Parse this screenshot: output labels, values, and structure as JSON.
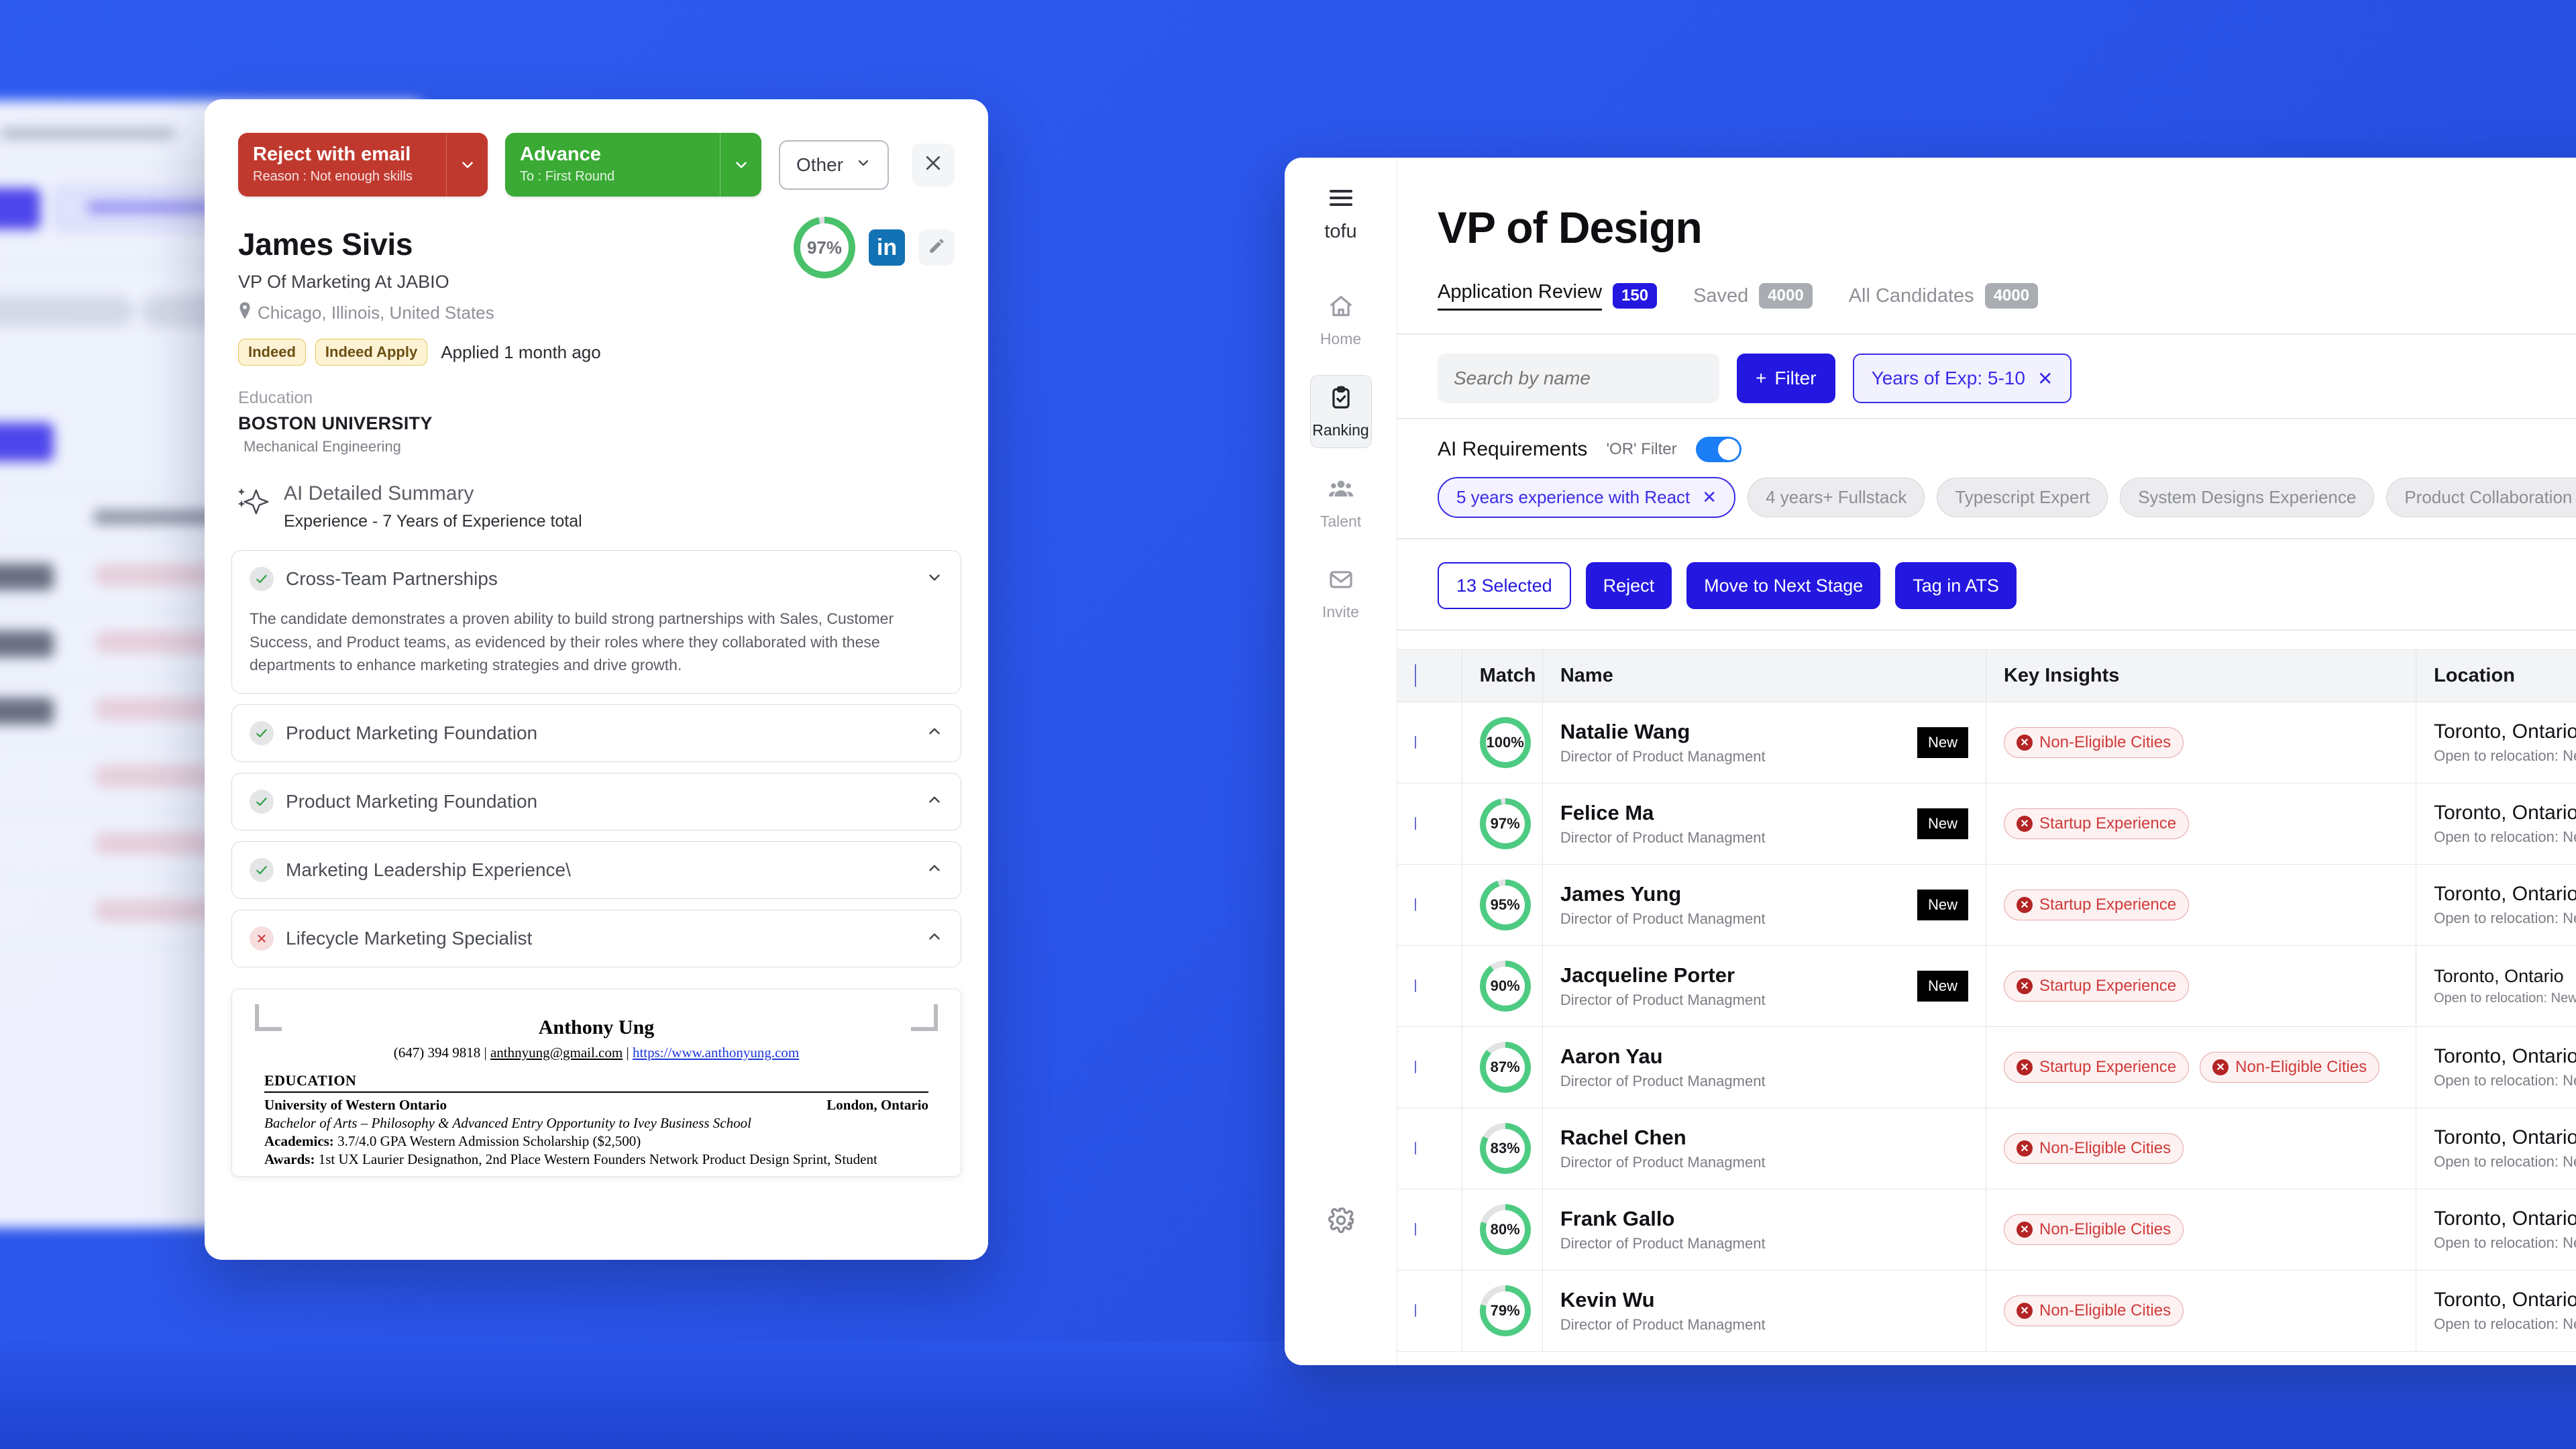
{
  "modal": {
    "reject_button": {
      "label": "Reject with email",
      "sub": "Reason : Not enough skills"
    },
    "advance_button": {
      "label": "Advance",
      "sub": "To : First Round"
    },
    "other_button": "Other",
    "candidate": {
      "name": "James Sivis",
      "title": "VP Of Marketing At JABIO",
      "location": "Chicago, Illinois, United States",
      "source_tag": "Indeed",
      "apply_tag": "Indeed Apply",
      "applied": "Applied 1 month ago",
      "score": "97%",
      "score_value": 97
    },
    "education": {
      "label": "Education",
      "school": "BOSTON UNIVERSITY",
      "program": "Mechanical Engineering"
    },
    "ai_summary": {
      "title": "AI Detailed Summary",
      "subtitle": "Experience - 7 Years of Experience total"
    },
    "accordions": [
      {
        "title": "Cross-Team Partnerships",
        "status": "pass",
        "expanded": true,
        "body": "The candidate demonstrates a proven ability to build strong partnerships with Sales, Customer Success, and Product teams, as evidenced by their roles where they collaborated with these departments to enhance marketing strategies and drive growth."
      },
      {
        "title": "Product Marketing Foundation",
        "status": "pass",
        "expanded": false,
        "body": ""
      },
      {
        "title": "Product Marketing Foundation",
        "status": "pass",
        "expanded": false,
        "body": ""
      },
      {
        "title": "Marketing Leadership Experience\\",
        "status": "pass",
        "expanded": false,
        "body": ""
      },
      {
        "title": "Lifecycle Marketing Specialist",
        "status": "fail",
        "expanded": false,
        "body": ""
      }
    ],
    "resume": {
      "name": "Anthony Ung",
      "phone": "(647) 394 9818",
      "email": "anthnyung@gmail.com",
      "website": "https://www.anthonyung.com",
      "section": "EDUCATION",
      "school": "University of Western Ontario",
      "school_location": "London, Ontario",
      "degree": "Bachelor of Arts – Philosophy & Advanced Entry Opportunity to Ivey Business School",
      "academics_label": "Academics:",
      "academics": "3.7/4.0 GPA Western Admission Scholarship ($2,500)",
      "awards_label": "Awards:",
      "awards": "1st UX Laurier Designathon, 2nd Place Western Founders Network Product Design Sprint, Student"
    }
  },
  "app": {
    "brand": "tofu",
    "rail": [
      {
        "label": "Home",
        "icon": "home-icon",
        "active": false
      },
      {
        "label": "Ranking",
        "icon": "clipboard-check-icon",
        "active": true
      },
      {
        "label": "Talent",
        "icon": "people-icon",
        "active": false
      },
      {
        "label": "Invite",
        "icon": "envelope-icon",
        "active": false
      }
    ],
    "page_title": "VP of Design",
    "tabs": [
      {
        "label": "Application Review",
        "count": "150",
        "active": true
      },
      {
        "label": "Saved",
        "count": "4000",
        "active": false
      },
      {
        "label": "All Candidates",
        "count": "4000",
        "active": false
      }
    ],
    "search": {
      "placeholder": "Search by name",
      "value": ""
    },
    "filter_button": "Filter",
    "active_filter_chip": "Years of Exp: 5-10",
    "ai_requirements": {
      "label": "AI Requirements",
      "or_filter_label": "'OR' Filter",
      "toggle_on": true,
      "chips": [
        {
          "label": "5 years experience with React",
          "selected": true
        },
        {
          "label": "4 years+  Fullstack",
          "selected": false
        },
        {
          "label": "Typescript Expert",
          "selected": false
        },
        {
          "label": "System Designs Experience",
          "selected": false
        },
        {
          "label": "Product Collaboration Experience",
          "selected": false
        }
      ]
    },
    "bulk_actions": {
      "selected_label": "13 Selected",
      "reject": "Reject",
      "move": "Move to Next Stage",
      "tag": "Tag in ATS"
    },
    "table": {
      "columns": [
        "",
        "Match",
        "Name",
        "Key Insights",
        "Location"
      ],
      "rows": [
        {
          "match": "100%",
          "match_value": 100,
          "name": "Natalie Wang",
          "role": "Director of Product Managment",
          "badge": "New",
          "insights": [
            "Non-Eligible Cities"
          ],
          "location": "Toronto, Ontario",
          "relocation": "Open to relocation: New York, San",
          "hovered": false
        },
        {
          "match": "97%",
          "match_value": 97,
          "name": "Felice Ma",
          "role": "Director of Product Managment",
          "badge": "New",
          "insights": [
            "Startup Experience"
          ],
          "location": "Toronto, Ontario",
          "relocation": "Open to relocation: New York, San",
          "hovered": false
        },
        {
          "match": "95%",
          "match_value": 95,
          "name": "James Yung",
          "role": "Director of Product Managment",
          "badge": "New",
          "insights": [
            "Startup Experience"
          ],
          "location": "Toronto, Ontario",
          "relocation": "Open to relocation: New York, San",
          "hovered": false
        },
        {
          "match": "90%",
          "match_value": 90,
          "name": "Jacqueline Porter",
          "role": "Director of Product Managment",
          "badge": "New",
          "insights": [
            "Startup Experience"
          ],
          "location": "Toronto, Ontario",
          "relocation": "Open to relocation: New York, San",
          "hovered": true
        },
        {
          "match": "87%",
          "match_value": 87,
          "name": "Aaron Yau",
          "role": "Director of Product Managment",
          "badge": "",
          "insights": [
            "Startup Experience",
            "Non-Eligible Cities"
          ],
          "location": "Toronto, Ontario",
          "relocation": "Open to relocation: New York, San",
          "hovered": false
        },
        {
          "match": "83%",
          "match_value": 83,
          "name": "Rachel Chen",
          "role": "Director of Product Managment",
          "badge": "",
          "insights": [
            "Non-Eligible Cities"
          ],
          "location": "Toronto, Ontario",
          "relocation": "Open to relocation: New York, San",
          "hovered": false
        },
        {
          "match": "80%",
          "match_value": 80,
          "name": "Frank Gallo",
          "role": "Director of Product Managment",
          "badge": "",
          "insights": [
            "Non-Eligible Cities"
          ],
          "location": "Toronto, Ontario",
          "relocation": "Open to relocation: New York, San",
          "hovered": false
        },
        {
          "match": "79%",
          "match_value": 79,
          "name": "Kevin Wu",
          "role": "Director of Product Managment",
          "badge": "",
          "insights": [
            "Non-Eligible Cities"
          ],
          "location": "Toronto, Ontario",
          "relocation": "Open to relocation: New York, San",
          "hovered": false
        }
      ]
    }
  },
  "colors": {
    "accent": "#2317e0",
    "background_blue": "#2b55ea",
    "reject_red": "#c0392f",
    "advance_green": "#3aaa35",
    "score_green": "#49c26b",
    "insight_red": "#cf3a3a"
  }
}
